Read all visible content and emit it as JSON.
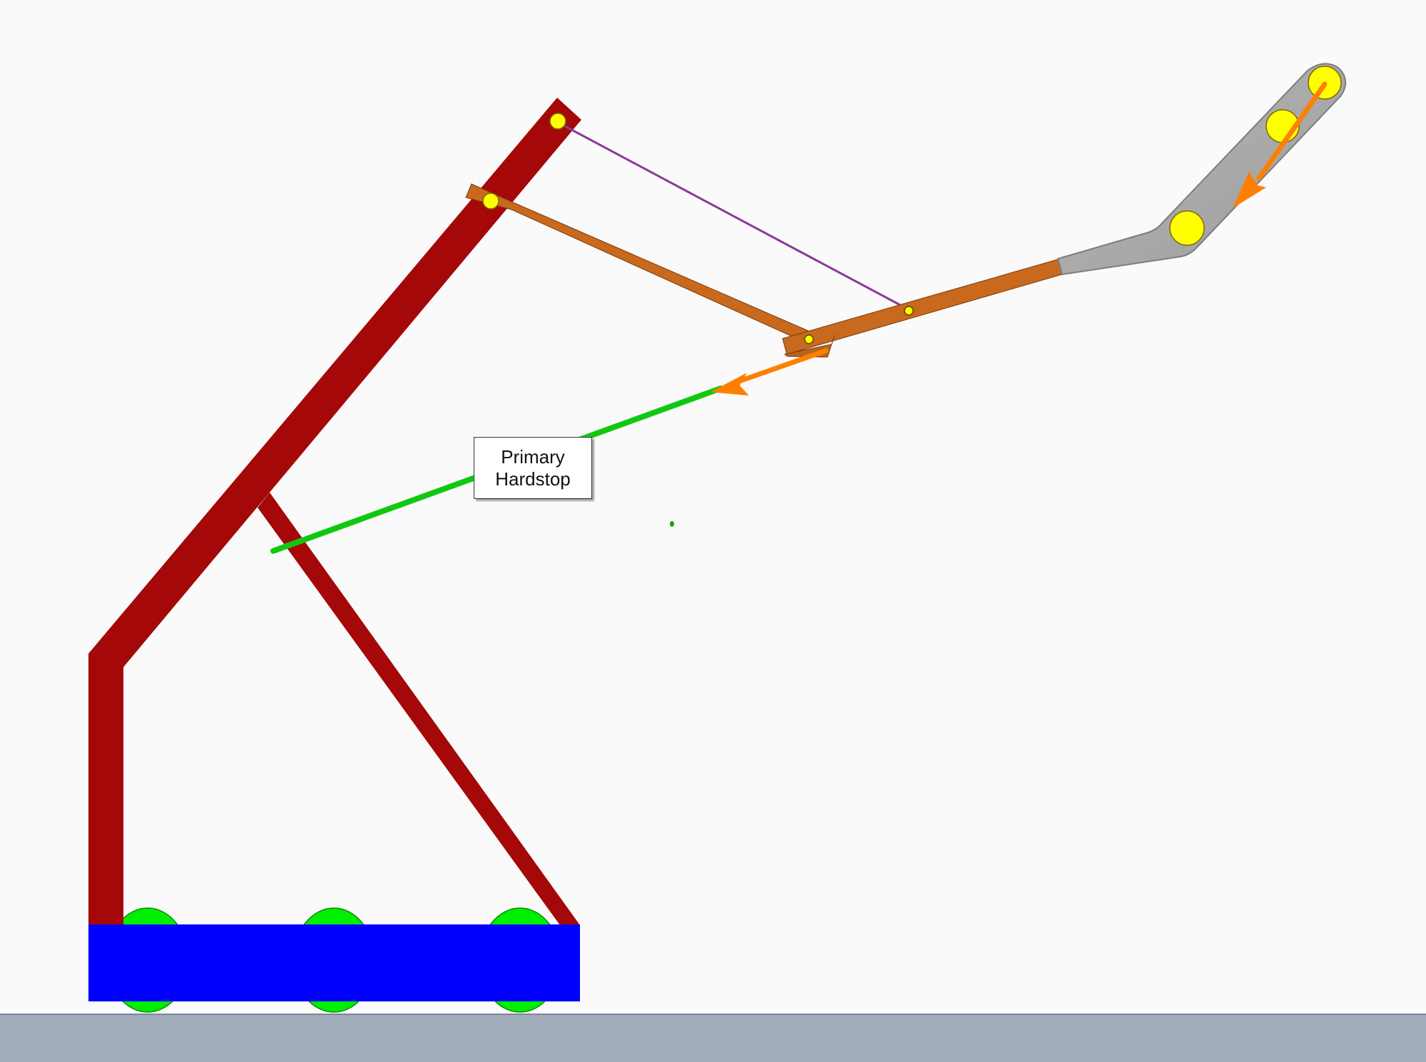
{
  "hardstop_label": {
    "line1": "Primary",
    "line2": "Hardstop"
  },
  "colors": {
    "background": "#fafafa",
    "floor": "#a0acba",
    "frame": "#a50808",
    "base": "#0000ff",
    "wheels": "#00ee00",
    "arm": "#c8691e",
    "arm_outline": "#7a3a0c",
    "end_plate": "#a9a9a9",
    "pivot": "#ffff00",
    "hardstop": "#11c811",
    "force_arrow": "#ff8000",
    "tie_line": "#8b3a9a"
  }
}
